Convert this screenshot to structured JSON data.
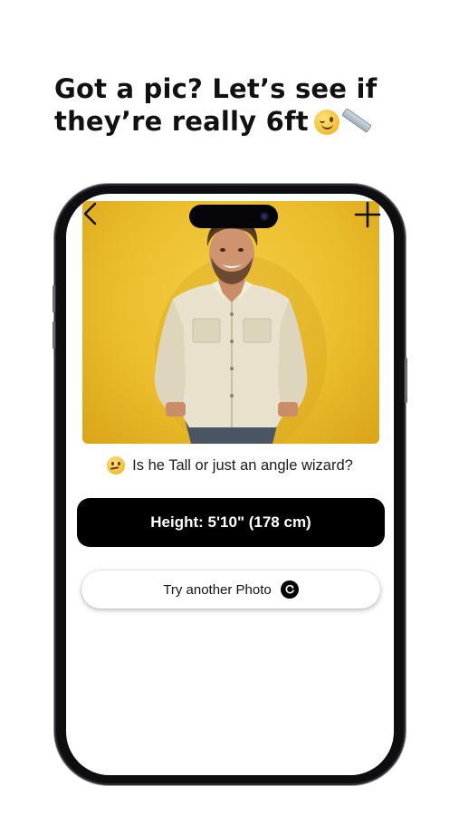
{
  "headline": {
    "line1": "Got a pic? Let’s see if",
    "line2": "they’re really 6ft"
  },
  "headline_emojis": [
    "winking-face-emoji",
    "ruler-emoji"
  ],
  "app": {
    "nav": {
      "back_icon": "chevron-left-icon",
      "add_icon": "plus-icon"
    },
    "photo": {
      "subject": "man in beige shirt against yellow background",
      "background_color": "#EBBD2C"
    },
    "question": "Is he Tall or just an angle wizard?",
    "question_emoji": "thinking-face-emoji",
    "result": {
      "label": "Height: 5'10\" (178 cm)"
    },
    "try_button": {
      "label": "Try another Photo",
      "icon": "refresh-icon"
    }
  },
  "colors": {
    "accent_yellow": "#EBBD2C",
    "result_bg": "#000000",
    "text": "#111111"
  }
}
